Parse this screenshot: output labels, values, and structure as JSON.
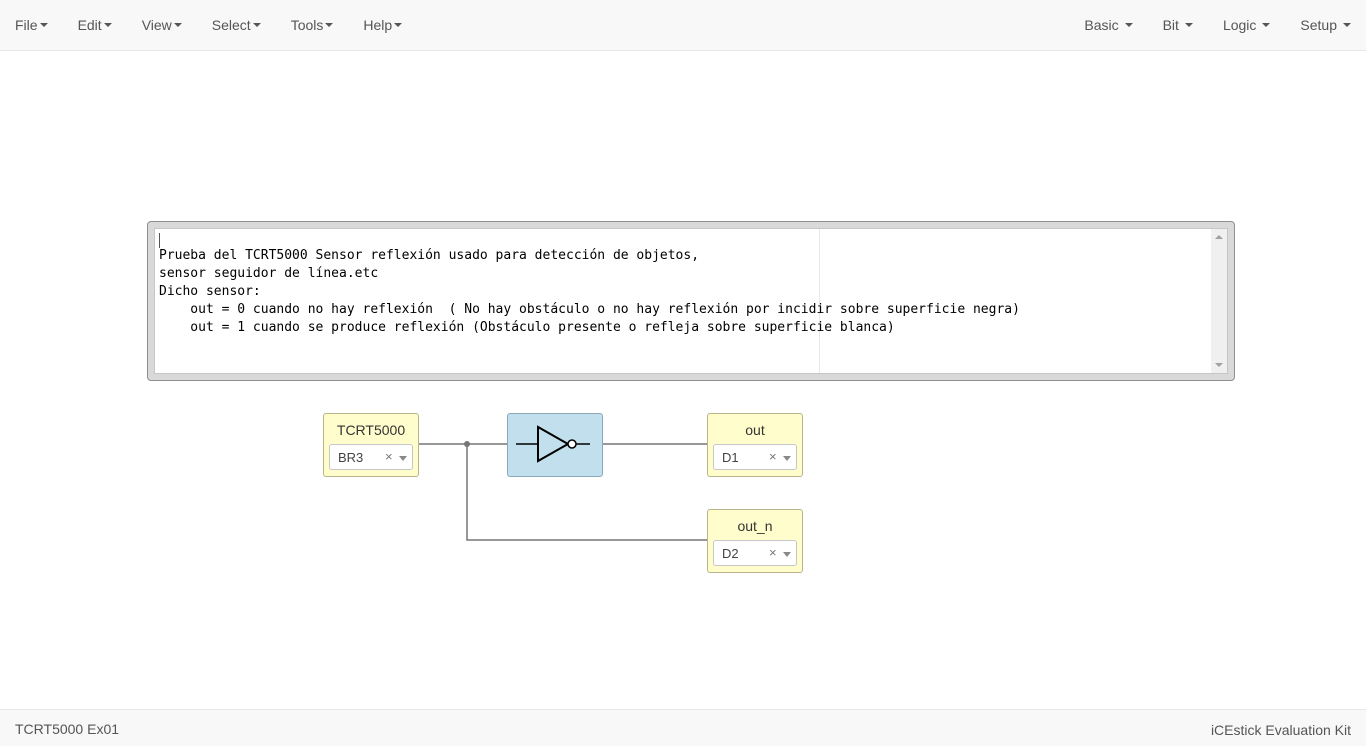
{
  "menubar": {
    "left": [
      {
        "label": "File"
      },
      {
        "label": "Edit"
      },
      {
        "label": "View"
      },
      {
        "label": "Select"
      },
      {
        "label": "Tools"
      },
      {
        "label": "Help"
      }
    ],
    "right": [
      {
        "label": "Basic"
      },
      {
        "label": "Bit"
      },
      {
        "label": "Logic"
      },
      {
        "label": "Setup"
      }
    ]
  },
  "comment": {
    "text": "Prueba del TCRT5000 Sensor reflexión usado para detección de objetos,\nsensor seguidor de línea.etc\nDicho sensor:\n    out = 0 cuando no hay reflexión  ( No hay obstáculo o no hay reflexión por incidir sobre superficie negra)\n    out = 1 cuando se produce reflexión (Obstáculo presente o refleja sobre superficie blanca)"
  },
  "blocks": {
    "input": {
      "label": "TCRT5000",
      "pin": "BR3"
    },
    "gate": {
      "icon": "not-gate-icon"
    },
    "out": {
      "label": "out",
      "pin": "D1"
    },
    "out_n": {
      "label": "out_n",
      "pin": "D2"
    },
    "clear_symbol": "×"
  },
  "footer": {
    "project": "TCRT5000 Ex01",
    "board": "iCEstick Evaluation Kit"
  },
  "colors": {
    "io_block": "#fffdcc",
    "gate_block": "#c1dfed",
    "wire": "#777777"
  }
}
